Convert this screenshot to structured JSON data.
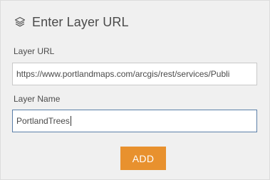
{
  "header": {
    "title": "Enter Layer URL",
    "icon": "layers-icon"
  },
  "form": {
    "url_label": "Layer URL",
    "url_value": "https://www.portlandmaps.com/arcgis/rest/services/Publi",
    "name_label": "Layer Name",
    "name_value": "PortlandTrees"
  },
  "actions": {
    "add_label": "ADD"
  },
  "colors": {
    "panel_bg": "#f0f0f0",
    "button_bg": "#e8912e",
    "focused_border": "#5b7fa8"
  }
}
